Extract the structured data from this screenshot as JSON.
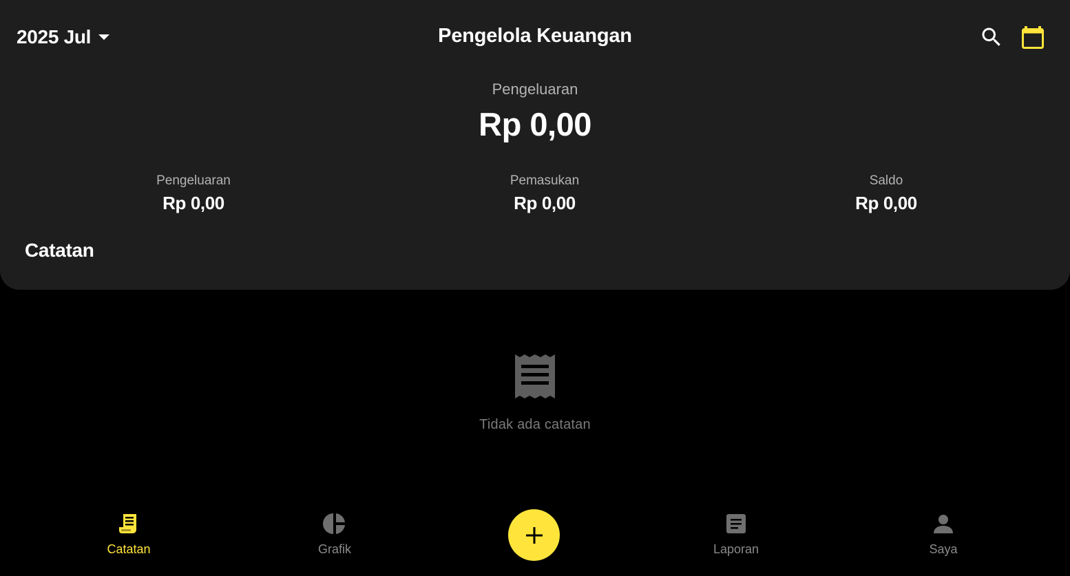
{
  "header": {
    "month_label": "2025 Jul",
    "title": "Pengelola Keuangan",
    "icons": {
      "dropdown": "chevron-down-icon",
      "search": "search-icon",
      "calendar": "calendar-icon"
    }
  },
  "summary": {
    "main_label": "Pengeluaran",
    "main_value": "Rp 0,00",
    "stats": [
      {
        "label": "Pengeluaran",
        "value": "Rp 0,00"
      },
      {
        "label": "Pemasukan",
        "value": "Rp 0,00"
      },
      {
        "label": "Saldo",
        "value": "Rp 0,00"
      }
    ]
  },
  "records": {
    "section_title": "Catatan",
    "empty_message": "Tidak ada catatan",
    "empty_icon": "receipt-icon"
  },
  "bottom_nav": {
    "items": [
      {
        "label": "Catatan",
        "icon": "receipt-icon",
        "active": true
      },
      {
        "label": "Grafik",
        "icon": "pie-chart-icon",
        "active": false
      },
      {
        "label": "Laporan",
        "icon": "report-icon",
        "active": false
      },
      {
        "label": "Saya",
        "icon": "person-icon",
        "active": false
      }
    ],
    "fab_icon": "plus-icon"
  },
  "colors": {
    "accent": "#ffe53b",
    "panel": "#1e1e1e",
    "background": "#000000",
    "muted_text": "#b3b3b3",
    "inactive": "#8a8a8a"
  }
}
